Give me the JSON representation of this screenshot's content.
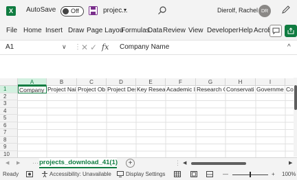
{
  "titlebar": {
    "app_icon": "excel-icon",
    "app_letter": "X",
    "autosave_label": "AutoSave",
    "autosave_state": "Off",
    "save_icon": "save-icon",
    "filename": "projec...",
    "filename_caret": "▾",
    "search_icon": "search-icon",
    "user_name": "Dierolf, Rachel",
    "avatar_initials": "DR",
    "pen_icon": "pen-icon",
    "minimize": "—",
    "maximize": "☐",
    "close": "✕"
  },
  "ribbon": {
    "tabs": [
      "File",
      "Home",
      "Insert",
      "Draw",
      "Page Layou",
      "Formulas",
      "Data",
      "Review",
      "View",
      "Developer",
      "Help",
      "Acrobat"
    ],
    "comment_icon": "comment-icon",
    "share_icon": "share-icon"
  },
  "formula_bar": {
    "name_box": "A1",
    "name_caret": "∨",
    "separator": "⋮",
    "cancel": "✕",
    "enter": "✓",
    "fx": "fx",
    "content": "Company Name",
    "expand": "^"
  },
  "grid": {
    "columns": [
      "A",
      "B",
      "C",
      "D",
      "E",
      "F",
      "G",
      "H",
      "I"
    ],
    "rows": [
      "1",
      "2",
      "3",
      "4",
      "5",
      "6",
      "7",
      "8",
      "9",
      "10"
    ],
    "header_row": [
      "Company N",
      "Project Nai",
      "Project Ob",
      "Project Des",
      "Key Resear",
      "Academic I",
      "Research C",
      "Conservati",
      "Governme",
      "Cor"
    ],
    "active_cell": "A1"
  },
  "sheets": {
    "nav_prev": "◀",
    "nav_next": "▶",
    "dots": "⋯",
    "active_sheet": "projects_download_41(1)",
    "add_sheet": "+",
    "more": "⋮"
  },
  "statusbar": {
    "ready": "Ready",
    "accessibility": "Accessibility: Unavailable",
    "display_settings": "Display Settings",
    "zoom_minus": "—",
    "zoom_plus": "+",
    "zoom_level": "100%",
    "zoom_fraction": 0.5
  },
  "colors": {
    "excel_green": "#107c41",
    "chrome_bg": "#f3f3f3",
    "grid_line": "#e1e1e1"
  }
}
